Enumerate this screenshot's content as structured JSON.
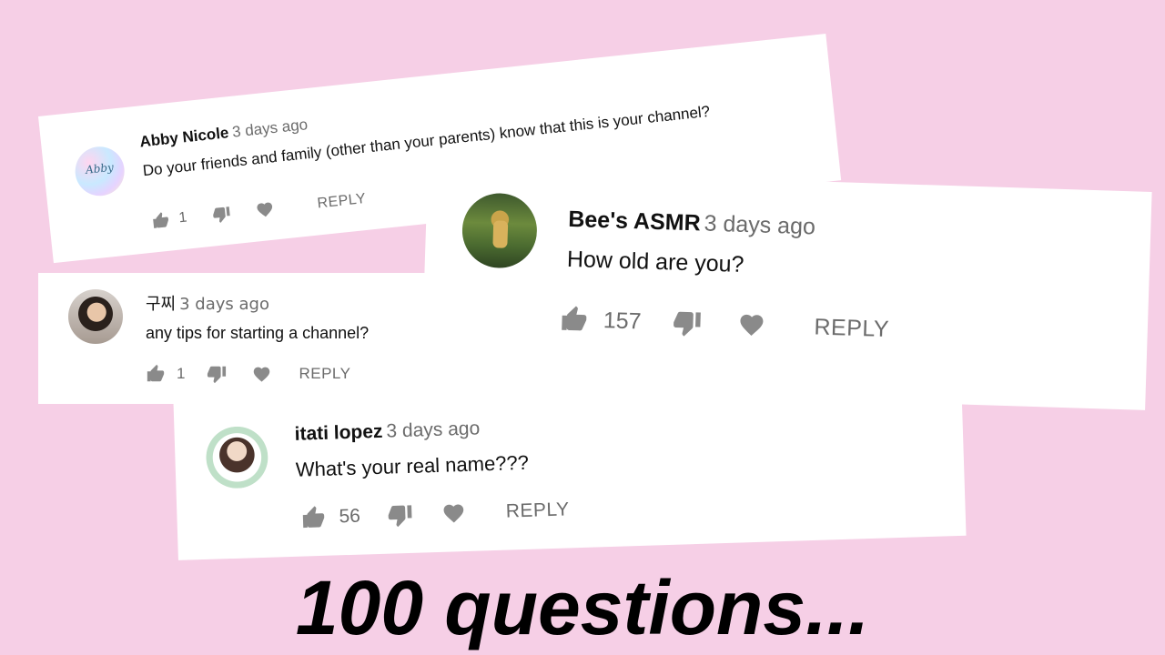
{
  "comments": [
    {
      "author": "Abby Nicole",
      "time": "3 days ago",
      "text": "Do your friends and family (other than your parents) know that this is your channel?",
      "likes": "1",
      "reply_label": "REPLY",
      "avatar_text": "Abby",
      "avatar_icon": "pastel-avatar-icon"
    },
    {
      "author": "구찌",
      "time": "3 days ago",
      "text": "any tips for starting a channel?",
      "likes": "1",
      "reply_label": "REPLY",
      "avatar_icon": "portrait-photo-avatar"
    },
    {
      "author": "Bee's ASMR",
      "time": "3 days ago",
      "text": "How old are you?",
      "likes": "157",
      "reply_label": "REPLY",
      "avatar_icon": "outdoor-photo-avatar"
    },
    {
      "author": "itati lopez",
      "time": "3 days ago",
      "text": "What's your real name???",
      "likes": "56",
      "reply_label": "REPLY",
      "avatar_icon": "illustrated-girl-avatar"
    }
  ],
  "headline": "100 questions...",
  "colors": {
    "background": "#f6cfe6",
    "card": "#ffffff",
    "icon": "#8a8a8a",
    "meta_text": "#6b6b6b"
  }
}
